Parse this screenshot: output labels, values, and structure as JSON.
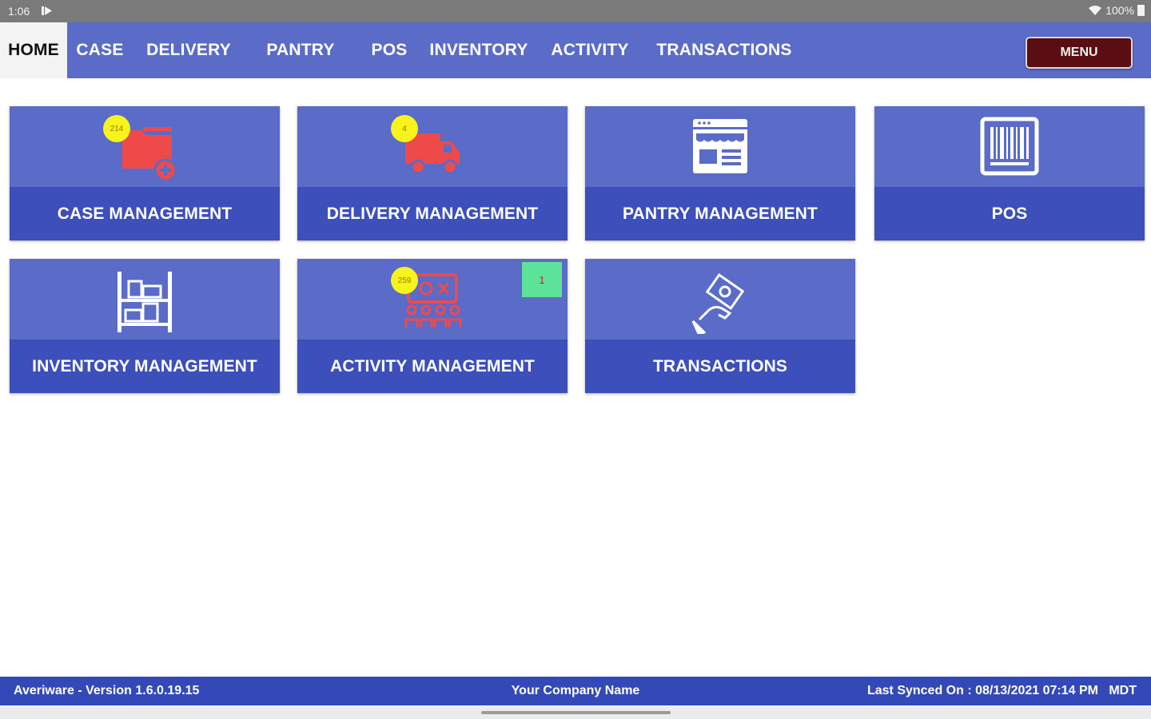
{
  "status_bar": {
    "time": "1:06",
    "battery": "100%"
  },
  "nav": {
    "tabs": [
      {
        "label": "HOME",
        "active": true
      },
      {
        "label": "CASE",
        "active": false
      },
      {
        "label": "DELIVERY",
        "active": false
      },
      {
        "label": "PANTRY",
        "active": false
      },
      {
        "label": "POS",
        "active": false
      },
      {
        "label": "INVENTORY",
        "active": false
      },
      {
        "label": "ACTIVITY",
        "active": false
      },
      {
        "label": "TRANSACTIONS",
        "active": false
      }
    ],
    "menu_label": "MENU"
  },
  "tiles": [
    {
      "label": "CASE MANAGEMENT",
      "icon": "folder-add-icon",
      "badge": "214"
    },
    {
      "label": "DELIVERY MANAGEMENT",
      "icon": "delivery-truck-icon",
      "badge": "4"
    },
    {
      "label": "PANTRY MANAGEMENT",
      "icon": "storefront-icon"
    },
    {
      "label": "POS",
      "icon": "barcode-icon"
    },
    {
      "label": "INVENTORY MANAGEMENT",
      "icon": "shelf-boxes-icon"
    },
    {
      "label": "ACTIVITY MANAGEMENT",
      "icon": "activity-group-icon",
      "badge": "259",
      "count": "1"
    },
    {
      "label": "TRANSACTIONS",
      "icon": "hand-coin-icon"
    }
  ],
  "footer": {
    "version": "Averiware - Version 1.6.0.19.15",
    "company": "Your Company Name",
    "last_synced": "Last Synced On : 08/13/2021 07:14 PM   MDT"
  },
  "colors": {
    "nav_bg": "#5a6bc8",
    "tile_top": "#5a6bc8",
    "tile_bottom": "#3c4fbb",
    "menu_bg": "#5a0d12",
    "footer_bg": "#3349b8",
    "badge": "#f6f41a",
    "count_box": "#5de29a",
    "icon_red": "#ee4a4a"
  }
}
